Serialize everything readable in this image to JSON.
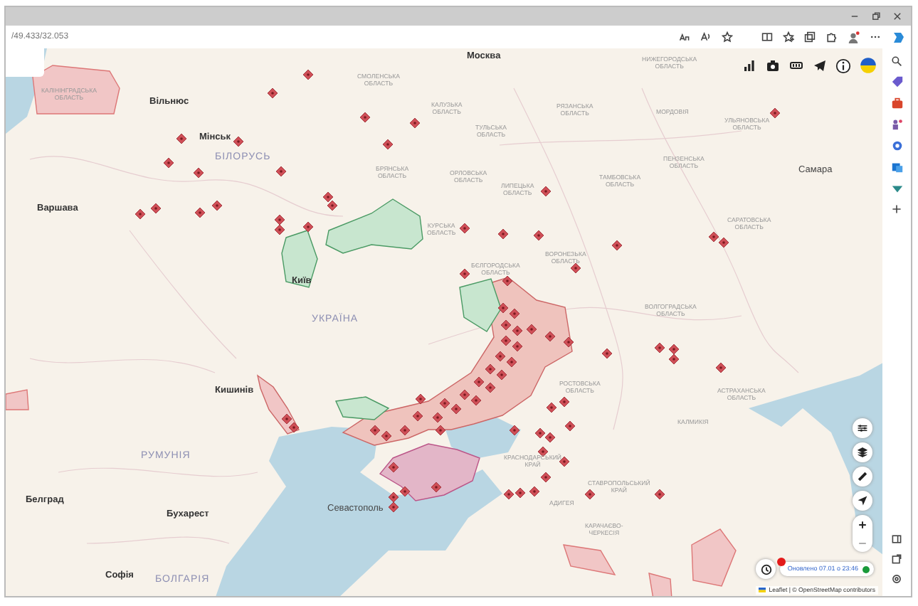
{
  "browser": {
    "address": "/49.433/32.053"
  },
  "map": {
    "labels": [
      {
        "text": "Москва",
        "kind": "capital"
      },
      {
        "text": "НИЖЕГОРОДСЬКА ОБЛАСТЬ",
        "kind": "region"
      },
      {
        "text": "СМОЛЕНСЬКА ОБЛАСТЬ",
        "kind": "region"
      },
      {
        "text": "КАЛІНІНГРАДСЬКА ОБЛАСТЬ",
        "kind": "region"
      },
      {
        "text": "Вільнюс",
        "kind": "capital"
      },
      {
        "text": "КАЛУЗЬКА ОБЛАСТЬ",
        "kind": "region"
      },
      {
        "text": "РЯЗАНСЬКА ОБЛАСТЬ",
        "kind": "region"
      },
      {
        "text": "МОРДОВІЯ",
        "kind": "region"
      },
      {
        "text": "УЛЬЯНОВСЬКА ОБЛАСТЬ",
        "kind": "region"
      },
      {
        "text": "ТУЛЬСЬКА ОБЛАСТЬ",
        "kind": "region"
      },
      {
        "text": "Мінськ",
        "kind": "capital"
      },
      {
        "text": "БІЛОРУСЬ",
        "kind": "country"
      },
      {
        "text": "ПЕНЗЕНСЬКА ОБЛАСТЬ",
        "kind": "region"
      },
      {
        "text": "БРЯНСЬКА ОБЛАСТЬ",
        "kind": "region"
      },
      {
        "text": "Самара",
        "kind": "city"
      },
      {
        "text": "ОРЛОВСЬКА ОБЛАСТЬ",
        "kind": "region"
      },
      {
        "text": "ТАМБОВСЬКА ОБЛАСТЬ",
        "kind": "region"
      },
      {
        "text": "ЛИПЕЦЬКА ОБЛАСТЬ",
        "kind": "region"
      },
      {
        "text": "Варшава",
        "kind": "capital"
      },
      {
        "text": "САРАТОВСЬКА ОБЛАСТЬ",
        "kind": "region"
      },
      {
        "text": "КУРСЬКА ОБЛАСТЬ",
        "kind": "region"
      },
      {
        "text": "ВОРОНЕЗЬКА ОБЛАСТЬ",
        "kind": "region"
      },
      {
        "text": "БЄЛГОРОДСЬКА ОБЛАСТЬ",
        "kind": "region"
      },
      {
        "text": "Київ",
        "kind": "capital"
      },
      {
        "text": "ВОЛГОГРАДСЬКА ОБЛАСТЬ",
        "kind": "region"
      },
      {
        "text": "УКРАЇНА",
        "kind": "country"
      },
      {
        "text": "Кишинів",
        "kind": "capital"
      },
      {
        "text": "РОСТОВСЬКА ОБЛАСТЬ",
        "kind": "region"
      },
      {
        "text": "АСТРАХАНСЬКА ОБЛАСТЬ",
        "kind": "region"
      },
      {
        "text": "КАЛМИКІЯ",
        "kind": "region"
      },
      {
        "text": "РУМУНІЯ",
        "kind": "country"
      },
      {
        "text": "КРАСНОДАРСЬКИЙ КРАЙ",
        "kind": "region"
      },
      {
        "text": "СТАВРОПОЛЬСЬКИЙ КРАЙ",
        "kind": "region"
      },
      {
        "text": "Белград",
        "kind": "capital"
      },
      {
        "text": "АДИГЕЯ",
        "kind": "region"
      },
      {
        "text": "Севастополь",
        "kind": "city"
      },
      {
        "text": "Бухарест",
        "kind": "capital"
      },
      {
        "text": "КАРАЧАЄВО-ЧЕРКЕСІЯ",
        "kind": "region"
      },
      {
        "text": "Софія",
        "kind": "capital"
      },
      {
        "text": "БОЛГАРІЯ",
        "kind": "country"
      }
    ],
    "status": {
      "updated": "Оновлено 07.01 о 23:46"
    },
    "attribution": "Leaflet | © OpenStreetMap contributors"
  }
}
